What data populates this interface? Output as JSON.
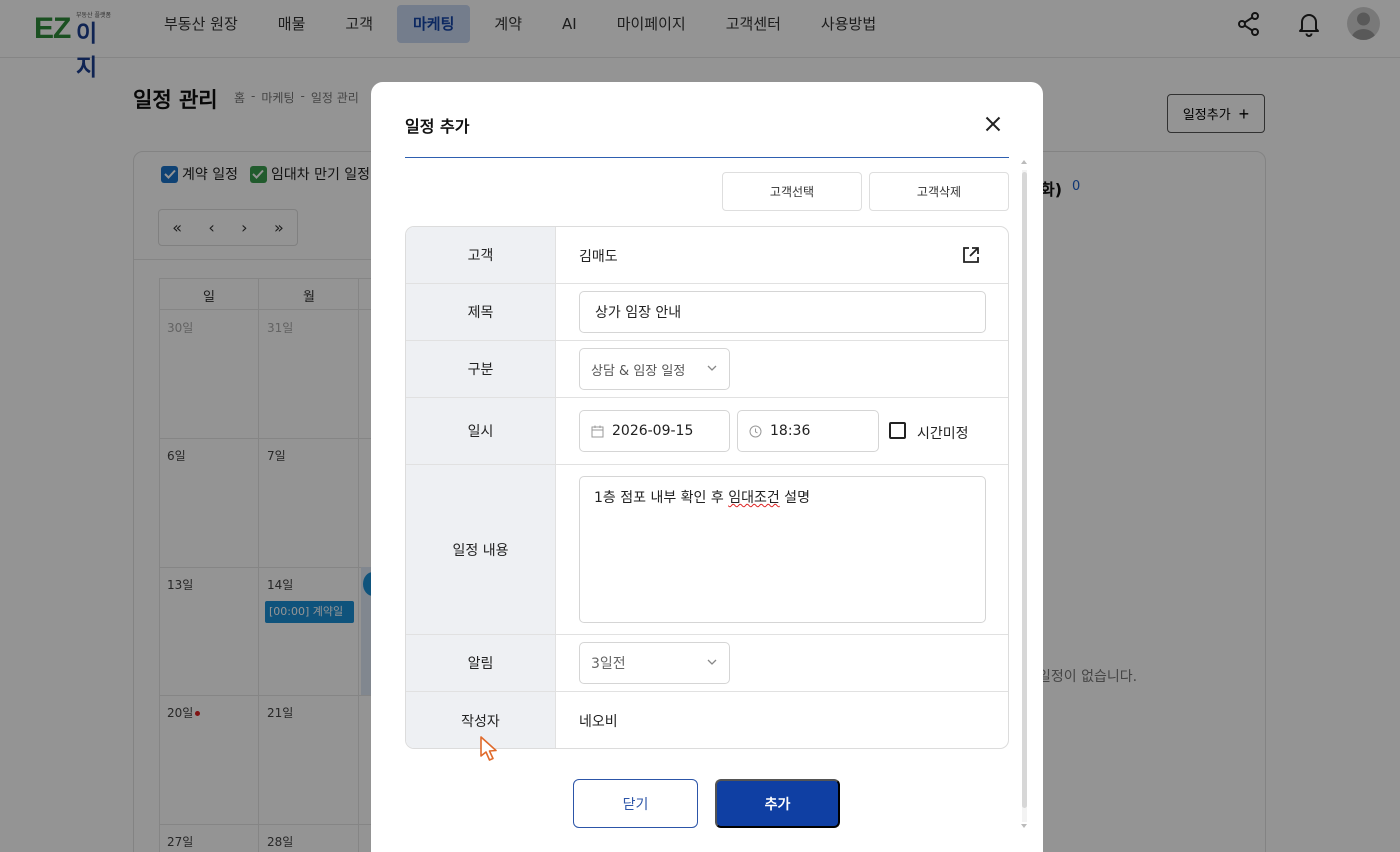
{
  "header": {
    "logo_main": "EZ",
    "logo_sub": "이지",
    "logo_tagline": "부동산 플랫폼",
    "nav": [
      "부동산 원장",
      "매물",
      "고객",
      "마케팅",
      "계약",
      "AI",
      "마이페이지",
      "고객센터",
      "사용방법"
    ],
    "active_nav": "마케팅",
    "icons": [
      "share-icon",
      "bell-icon",
      "avatar"
    ]
  },
  "page": {
    "title": "일정 관리",
    "breadcrumb": [
      "홈",
      "-",
      "마케팅",
      "-",
      "일정 관리"
    ],
    "add_button": "일정추가",
    "filters": [
      {
        "label": "계약 일정",
        "checked": true,
        "color": "#1a73c9"
      },
      {
        "label": "임대차 만기 일정",
        "checked": true,
        "color": "#3a9e4e"
      }
    ],
    "calendar": {
      "nav": [
        "«",
        "‹",
        "›",
        "»"
      ],
      "weekdays": [
        "일",
        "월"
      ],
      "days": [
        {
          "row": 0,
          "col": 0,
          "label": "30일",
          "dim": true
        },
        {
          "row": 0,
          "col": 1,
          "label": "31일",
          "dim": true
        },
        {
          "row": 1,
          "col": 0,
          "label": "6일"
        },
        {
          "row": 1,
          "col": 1,
          "label": "7일"
        },
        {
          "row": 2,
          "col": 0,
          "label": "13일"
        },
        {
          "row": 2,
          "col": 1,
          "label": "14일"
        },
        {
          "row": 3,
          "col": 0,
          "label": "20일",
          "dot": true
        },
        {
          "row": 3,
          "col": 1,
          "label": "21일"
        },
        {
          "row": 4,
          "col": 0,
          "label": "27일"
        },
        {
          "row": 4,
          "col": 1,
          "label": "28일"
        }
      ],
      "event": "[00:00]  계약일"
    },
    "side_head": "화)",
    "side_count": "0",
    "empty_message": "일정이 없습니다."
  },
  "modal": {
    "title": "일정 추가",
    "select_customer": "고객선택",
    "delete_customer": "고객삭제",
    "fields": {
      "customer_label": "고객",
      "customer_value": "김매도",
      "title_label": "제목",
      "title_value": "상가 임장 안내",
      "category_label": "구분",
      "category_value": "상담 & 임장 일정",
      "datetime_label": "일시",
      "date_value": "2026-09-15",
      "time_value": "18:36",
      "time_undecided": "시간미정",
      "content_label": "일정 내용",
      "content_value_before": "1층 점포 내부 확인 후 ",
      "content_value_wavy": "임대조건",
      "content_value_after": " 설명",
      "alarm_label": "알림",
      "alarm_value": "3일전",
      "author_label": "작성자",
      "author_value": "네오비"
    },
    "close_button": "닫기",
    "add_button": "추가"
  }
}
